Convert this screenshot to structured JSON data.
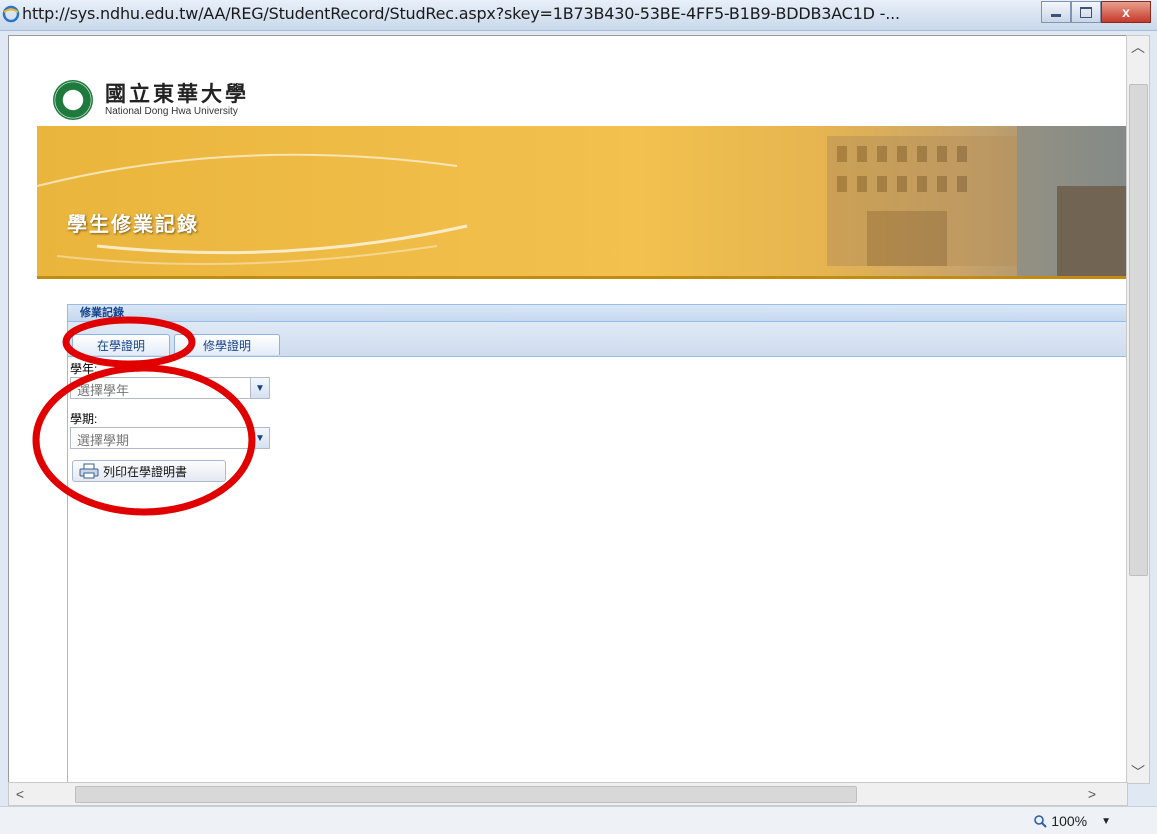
{
  "window": {
    "url": "http://sys.ndhu.edu.tw/AA/REG/StudentRecord/StudRec.aspx?skey=1B73B430-53BE-4FF5-B1B9-BDDB3AC1D -...",
    "close_label": "x"
  },
  "header": {
    "university_zh": "國立東華大學",
    "university_en": "National Dong Hwa University"
  },
  "banner": {
    "title": "學生修業記錄"
  },
  "panel": {
    "title": "修業記錄",
    "tabs": [
      {
        "label": "在學證明",
        "active": true
      },
      {
        "label": "修學證明",
        "active": false
      }
    ]
  },
  "form": {
    "year_label": "學年:",
    "year_placeholder": "選擇學年",
    "term_label": "學期:",
    "term_placeholder": "選擇學期",
    "print_button": "列印在學證明書"
  },
  "statusbar": {
    "zoom": "100%"
  },
  "colors": {
    "annotation": "#e00000",
    "banner": "#f2c14e",
    "panel_border": "#99bbe8"
  }
}
